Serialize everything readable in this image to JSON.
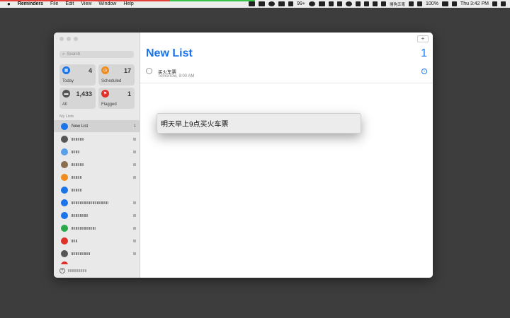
{
  "menubar": {
    "apple": "",
    "items": [
      "Reminders",
      "File",
      "Edit",
      "View",
      "Window",
      "Help"
    ],
    "tray_badge": "99+",
    "input_method": "搜狗五笔",
    "battery": "100%",
    "datetime": "Thu 3:42 PM"
  },
  "sidebar": {
    "search_placeholder": "Search",
    "smart_lists": [
      {
        "label": "Today",
        "count": "4",
        "color": "#1a73e8"
      },
      {
        "label": "Scheduled",
        "count": "17",
        "color": "#f08c1d"
      },
      {
        "label": "All",
        "count": "1,433",
        "color": "#555555"
      },
      {
        "label": "Flagged",
        "count": "1",
        "color": "#e0302a"
      }
    ],
    "my_lists_header": "My Lists",
    "selected_list": {
      "name": "New List",
      "count": "1",
      "color": "#1a73e8"
    },
    "list_colors": [
      "#555555",
      "#5aa0e8",
      "#8a6c4f",
      "#f08c1d",
      "#1a73e8",
      "#1a73e8",
      "#1a73e8",
      "#2aa84a",
      "#e0302a",
      "#555555",
      "#e0302a"
    ]
  },
  "main": {
    "add_label": "+",
    "title": "New List",
    "count": "1",
    "reminder": {
      "title": "买火车票",
      "subtitle": "Tomorrow, 9:00 AM",
      "info": "i"
    }
  },
  "popup": {
    "text": "明天早上9点买火车票"
  }
}
